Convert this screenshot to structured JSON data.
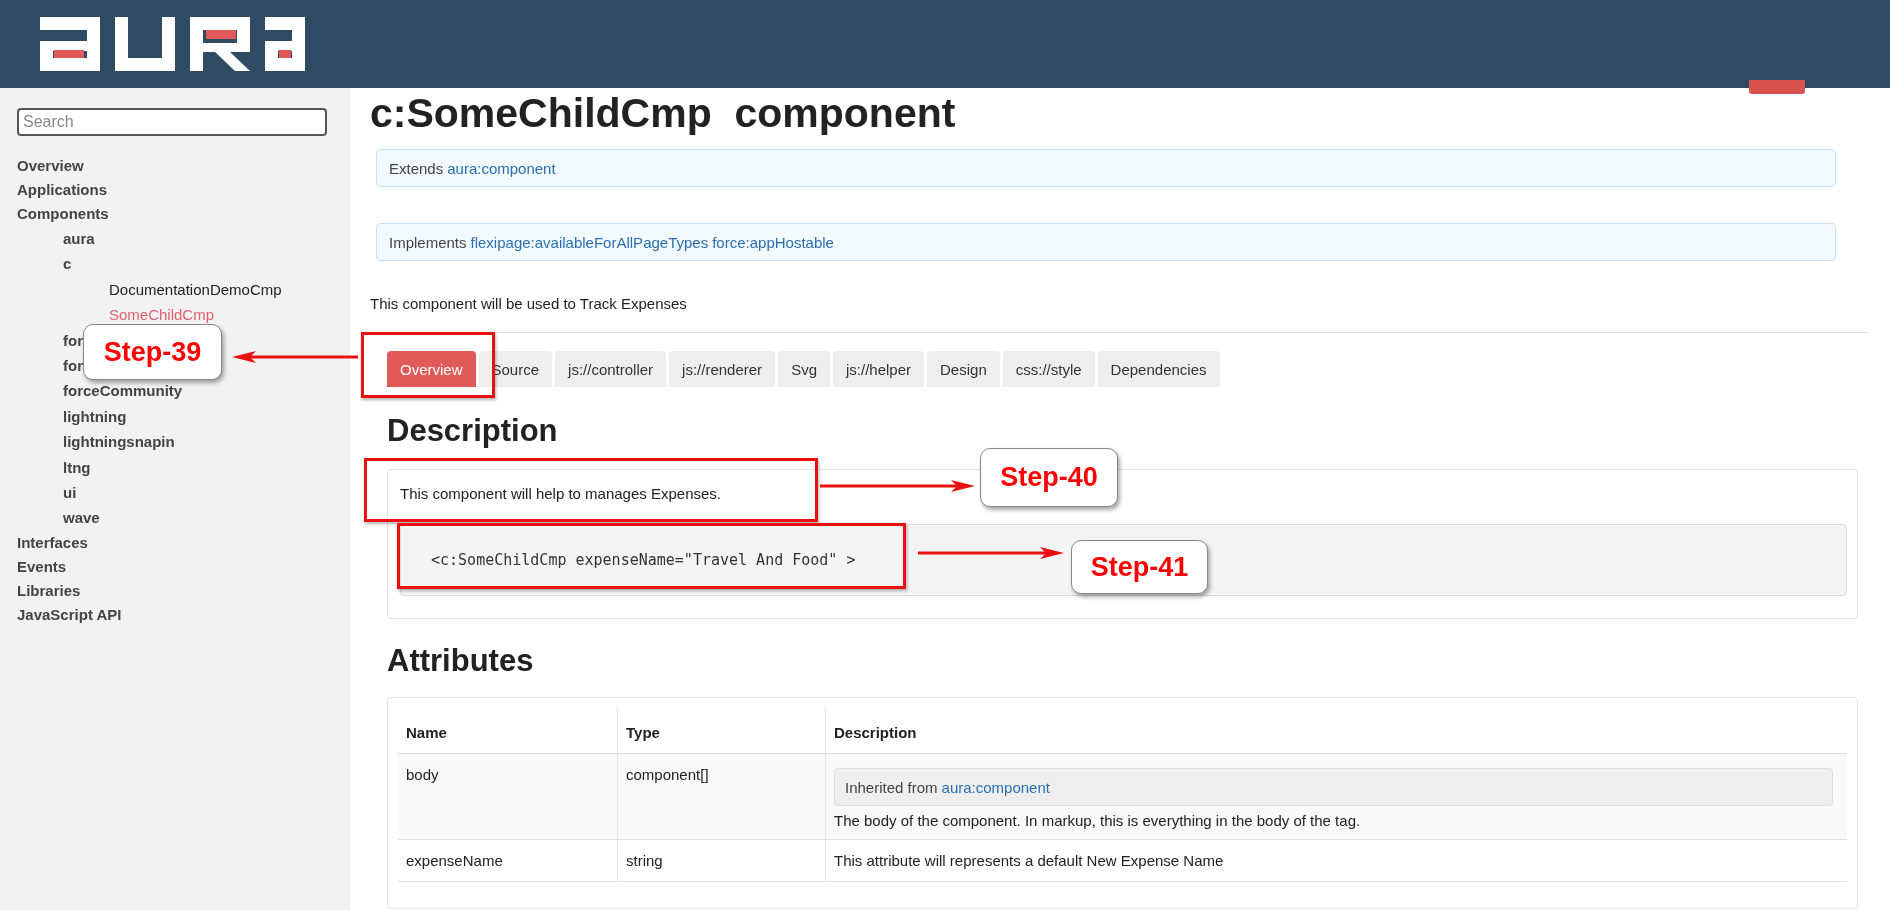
{
  "sidebar": {
    "search": {
      "placeholder": "Search"
    },
    "items": [
      {
        "label": "Overview",
        "selected": false
      },
      {
        "label": "Applications",
        "selected": false
      },
      {
        "label": "Components",
        "selected": false,
        "children": [
          {
            "label": "aura",
            "selected": false
          },
          {
            "label": "c",
            "selected": false,
            "children": [
              {
                "label": "DocumentationDemoCmp",
                "selected": false
              },
              {
                "label": "SomeChildCmp",
                "selected": true
              }
            ]
          },
          {
            "label": "for",
            "selected": false
          },
          {
            "label": "for",
            "selected": false
          },
          {
            "label": "forceCommunity",
            "selected": false
          },
          {
            "label": "lightning",
            "selected": false
          },
          {
            "label": "lightningsnapin",
            "selected": false
          },
          {
            "label": "ltng",
            "selected": false
          },
          {
            "label": "ui",
            "selected": false
          },
          {
            "label": "wave",
            "selected": false
          }
        ]
      },
      {
        "label": "Interfaces",
        "selected": false
      },
      {
        "label": "Events",
        "selected": false
      },
      {
        "label": "Libraries",
        "selected": false
      },
      {
        "label": "JavaScript API",
        "selected": false
      }
    ]
  },
  "main": {
    "title": "c:SomeChildCmp  component",
    "extends": {
      "label": "Extends",
      "links": [
        "aura:component"
      ]
    },
    "implements": {
      "label": "Implements",
      "links": [
        "flexipage:availableForAllPageTypes",
        "force:appHostable"
      ]
    },
    "summary": "This component will be used to Track Expenses",
    "tabs": [
      {
        "label": "Overview",
        "selected": true
      },
      {
        "label": "Source",
        "selected": false
      },
      {
        "label": "js://controller",
        "selected": false
      },
      {
        "label": "js://renderer",
        "selected": false
      },
      {
        "label": "Svg",
        "selected": false
      },
      {
        "label": "js://helper",
        "selected": false
      },
      {
        "label": "Design",
        "selected": false
      },
      {
        "label": "css://style",
        "selected": false
      },
      {
        "label": "Dependencies",
        "selected": false
      }
    ],
    "description": {
      "heading": "Description",
      "text": "This component will help to manages Expenses.",
      "code": "<c:SomeChildCmp expenseName=\"Travel And Food\" >"
    },
    "attributes": {
      "heading": "Attributes",
      "columns": [
        "Name",
        "Type",
        "Description"
      ],
      "rows": [
        {
          "name": "body",
          "type": "component[]",
          "inherited_label": "Inherited from",
          "inherited_link": "aura:component",
          "description": "The body of the component. In markup, this is everything in the body of the tag."
        },
        {
          "name": "expenseName",
          "type": "string",
          "description": "This attribute will represents a default New Expense Name"
        }
      ]
    }
  },
  "annotations": [
    {
      "label": "Step-39"
    },
    {
      "label": "Step-40"
    },
    {
      "label": "Step-41"
    }
  ]
}
